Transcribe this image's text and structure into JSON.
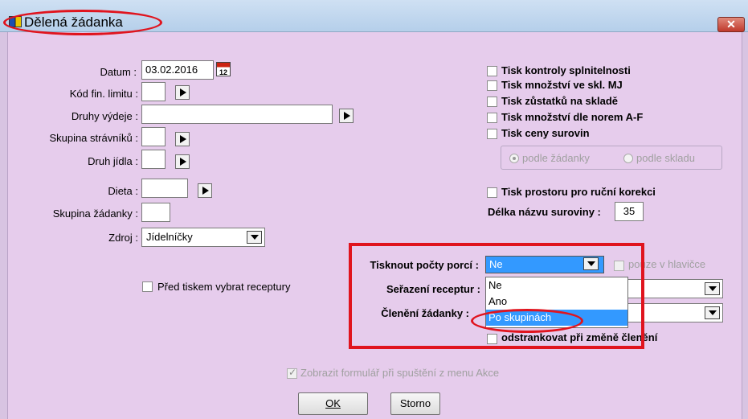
{
  "window": {
    "title": "Dělená žádanka",
    "close_symbol": "✕"
  },
  "left": {
    "datum_label": "Datum :",
    "datum_value": "03.02.2016",
    "calendar_glyph": "12",
    "kod_fin_limitu_label": "Kód fin. limitu :",
    "druhy_vydeje_label": "Druhy výdeje :",
    "skupina_stravniku_label": "Skupina strávníků :",
    "druh_jidla_label": "Druh jídla :",
    "dieta_label": "Dieta :",
    "skupina_zadanky_label": "Skupina žádanky :",
    "zdroj_label": "Zdroj :",
    "zdroj_value": "Jídelníčky",
    "pred_tiskem_label": "Před tiskem vybrat receptury"
  },
  "right": {
    "checkboxes": [
      "Tisk kontroly splnitelnosti",
      "Tisk množství ve skl. MJ",
      "Tisk zůstatků na skladě",
      "Tisk množství dle norem A-F",
      "Tisk ceny surovin"
    ],
    "radio_podle_zadanky": "podle žádanky",
    "radio_podle_skladu": "podle skladu",
    "tisk_prostoru": "Tisk prostoru pro ruční korekci",
    "delka_label": "Délka názvu suroviny :",
    "delka_value": "35"
  },
  "print_section": {
    "tisknout_label": "Tisknout počty porcí :",
    "tisknout_value": "Ne",
    "pouze_v_hlavicce": "pouze v hlavičce",
    "serazeni_label": "Seřazení receptur :",
    "cleneni_label": "Členění žádanky :",
    "odstrankovat": "odstrankovat při změně členění",
    "dropdown_options": [
      "Ne",
      "Ano",
      "Po skupinách"
    ]
  },
  "footer": {
    "zobrazit_label": "Zobrazit formulář při spuštění z menu Akce",
    "ok_label": "OK",
    "storno_label": "Storno"
  }
}
